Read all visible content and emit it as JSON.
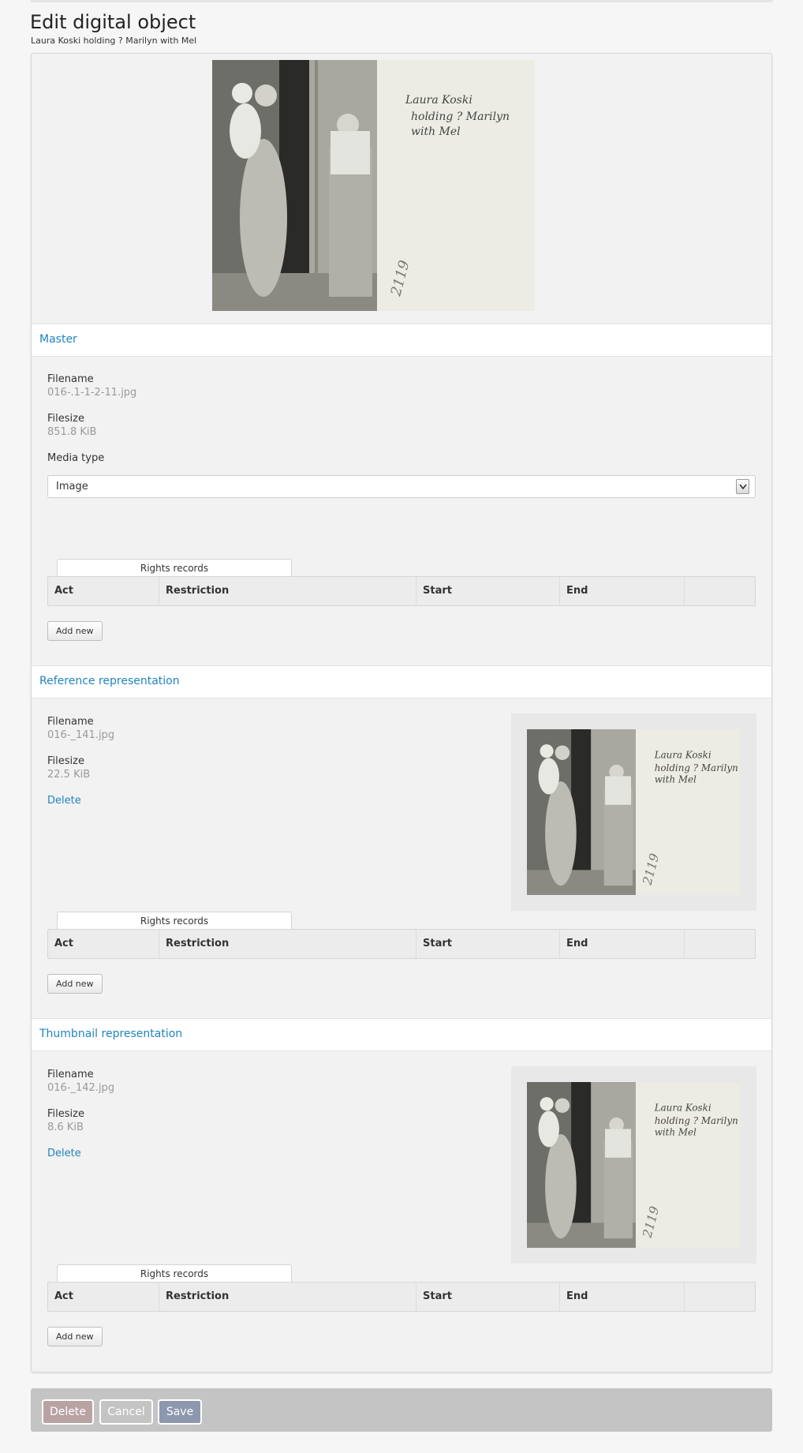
{
  "page": {
    "title": "Edit digital object",
    "subtitle": "Laura Koski holding ? Marilyn with Mel"
  },
  "photo": {
    "handwriting_line1": "Laura Koski",
    "handwriting_line2": "holding ? Marilyn",
    "handwriting_line3": "with Mel",
    "number": "2119"
  },
  "master": {
    "heading": "Master",
    "filename_label": "Filename",
    "filename_value": "016-.1-1-2-11.jpg",
    "filesize_label": "Filesize",
    "filesize_value": "851.8 KiB",
    "media_type_label": "Media type",
    "media_type_value": "Image",
    "rights_tab": "Rights records",
    "columns": [
      "Act",
      "Restriction",
      "Start",
      "End"
    ],
    "add_new": "Add new"
  },
  "reference": {
    "heading": "Reference representation",
    "filename_label": "Filename",
    "filename_value": "016-_141.jpg",
    "filesize_label": "Filesize",
    "filesize_value": "22.5 KiB",
    "delete_label": "Delete",
    "rights_tab": "Rights records",
    "columns": [
      "Act",
      "Restriction",
      "Start",
      "End"
    ],
    "add_new": "Add new"
  },
  "thumbnail": {
    "heading": "Thumbnail representation",
    "filename_label": "Filename",
    "filename_value": "016-_142.jpg",
    "filesize_label": "Filesize",
    "filesize_value": "8.6 KiB",
    "delete_label": "Delete",
    "rights_tab": "Rights records",
    "columns": [
      "Act",
      "Restriction",
      "Start",
      "End"
    ],
    "add_new": "Add new"
  },
  "footer": {
    "delete": "Delete",
    "cancel": "Cancel",
    "save": "Save"
  },
  "colors": {
    "link": "#1f84c0",
    "delete_button": "#b9a2a2",
    "save_button": "#8d97ad",
    "footer_bg": "#c4c4c4"
  }
}
